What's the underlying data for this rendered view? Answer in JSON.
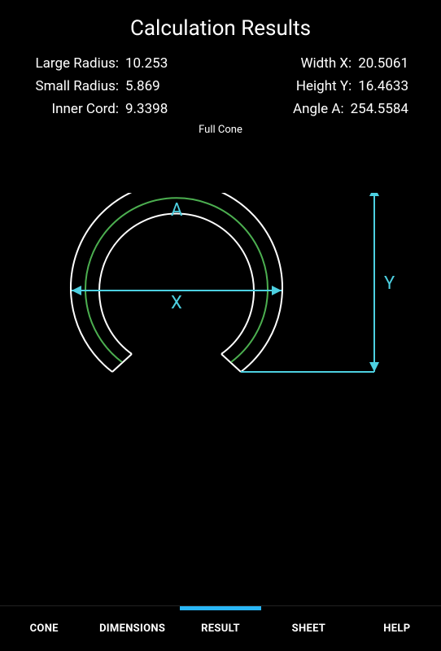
{
  "header": {
    "title": "Calculation Results",
    "subtitle": "Full Cone"
  },
  "results": {
    "large_radius_label": "Large Radius:",
    "large_radius_value": "10.253",
    "small_radius_label": "Small Radius:",
    "small_radius_value": "5.869",
    "inner_cord_label": "Inner Cord:",
    "inner_cord_value": "9.3398",
    "width_x_label": "Width X:",
    "width_x_value": "20.5061",
    "height_y_label": "Height Y:",
    "height_y_value": "16.4633",
    "angle_a_label": "Angle A:",
    "angle_a_value": "254.5584"
  },
  "diagram": {
    "label_a": "A",
    "label_x": "X",
    "label_y": "Y"
  },
  "tabs": {
    "cone": "CONE",
    "dimensions": "DIMENSIONS",
    "result": "RESULT",
    "sheet": "SHEET",
    "help": "HELP"
  }
}
